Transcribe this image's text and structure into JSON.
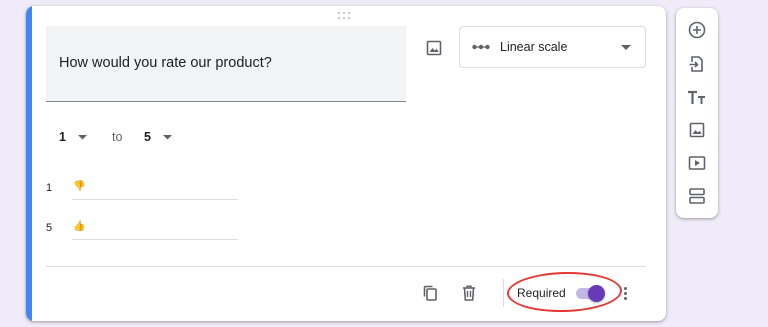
{
  "question": {
    "title": "How would you rate our product?"
  },
  "question_type": {
    "label": "Linear scale",
    "icon": "linear-scale-icon"
  },
  "scale": {
    "min_value": "1",
    "to_label": "to",
    "max_value": "5"
  },
  "scale_labels": [
    {
      "number": "1",
      "emoji": "👎"
    },
    {
      "number": "5",
      "emoji": "👍"
    }
  ],
  "footer": {
    "required_label": "Required",
    "required_on": true
  },
  "toolbar": {
    "tools": [
      "add-question-icon",
      "import-questions-icon",
      "add-title-icon",
      "add-image-icon",
      "add-video-icon",
      "add-section-icon"
    ]
  },
  "colors": {
    "accent": "#4285f4",
    "toggle": "#673ab7",
    "highlight": "#e53935",
    "background": "#f0ebf8"
  }
}
